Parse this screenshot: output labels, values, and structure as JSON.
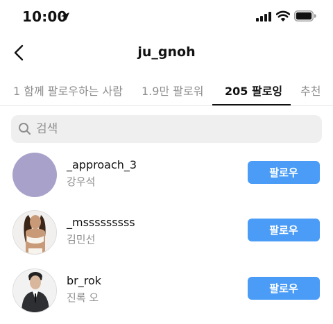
{
  "status_bar": {
    "time": "10:00"
  },
  "header": {
    "title": "ju_gnoh"
  },
  "tabs": [
    {
      "label": "1 함께 팔로우하는 사람"
    },
    {
      "label": "1.9만 팔로워"
    },
    {
      "label": "205 팔로잉"
    },
    {
      "label": "추천"
    }
  ],
  "search": {
    "placeholder": "검색",
    "value": ""
  },
  "users": [
    {
      "username": "_approach_3",
      "fullname": "강우석",
      "button": "팔로우"
    },
    {
      "username": "_msssssssss",
      "fullname": "김민선",
      "button": "팔로우"
    },
    {
      "username": "br_rok",
      "fullname": "진록 오",
      "button": "팔로우"
    }
  ],
  "colors": {
    "accent": "#4a9cf6",
    "secondary_text": "#8e8e8e",
    "avatar_placeholder": "#a8a2cb"
  }
}
